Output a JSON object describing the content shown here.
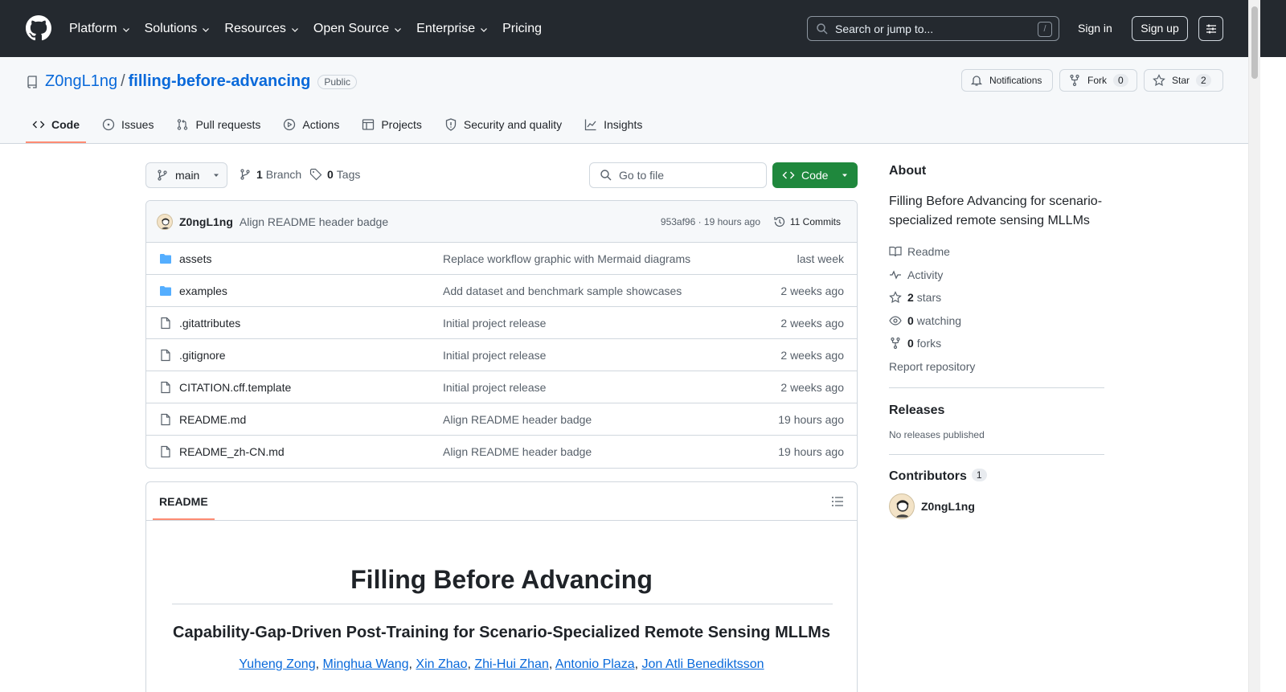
{
  "topnav": {
    "items": [
      "Platform",
      "Solutions",
      "Resources",
      "Open Source",
      "Enterprise",
      "Pricing"
    ],
    "search_placeholder": "Search or jump to...",
    "search_shortcut": "/",
    "signin": "Sign in",
    "signup": "Sign up"
  },
  "repo": {
    "owner": "Z0ngL1ng",
    "separator": "/",
    "name": "filling-before-advancing",
    "visibility": "Public",
    "notifications_label": "Notifications",
    "fork_label": "Fork",
    "fork_count": "0",
    "star_label": "Star",
    "star_count": "2"
  },
  "tabs": [
    "Code",
    "Issues",
    "Pull requests",
    "Actions",
    "Projects",
    "Security and quality",
    "Insights"
  ],
  "toolbar": {
    "branch": "main",
    "branch_count": "1",
    "branch_label": "Branch",
    "tag_count": "0",
    "tag_label": "Tags",
    "goto_placeholder": "Go to file",
    "code_label": "Code"
  },
  "commit": {
    "author": "Z0ngL1ng",
    "message": "Align README header badge",
    "hash_age": "953af96 · 19 hours ago",
    "commits": "11 Commits"
  },
  "files": [
    {
      "type": "folder",
      "name": "assets",
      "message": "Replace workflow graphic with Mermaid diagrams",
      "age": "last week"
    },
    {
      "type": "folder",
      "name": "examples",
      "message": "Add dataset and benchmark sample showcases",
      "age": "2 weeks ago"
    },
    {
      "type": "file",
      "name": ".gitattributes",
      "message": "Initial project release",
      "age": "2 weeks ago"
    },
    {
      "type": "file",
      "name": ".gitignore",
      "message": "Initial project release",
      "age": "2 weeks ago"
    },
    {
      "type": "file",
      "name": "CITATION.cff.template",
      "message": "Initial project release",
      "age": "2 weeks ago"
    },
    {
      "type": "file",
      "name": "README.md",
      "message": "Align README header badge",
      "age": "19 hours ago"
    },
    {
      "type": "file",
      "name": "README_zh-CN.md",
      "message": "Align README header badge",
      "age": "19 hours ago"
    }
  ],
  "readme": {
    "tab": "README",
    "title": "Filling Before Advancing",
    "subtitle": "Capability-Gap-Driven Post-Training for Scenario-Specialized Remote Sensing MLLMs",
    "authors": [
      "Yuheng Zong",
      "Minghua Wang",
      "Xin Zhao",
      "Zhi-Hui Zhan",
      "Antonio Plaza",
      "Jon Atli Benediktsson"
    ]
  },
  "about": {
    "heading": "About",
    "description": "Filling Before Advancing for scenario-specialized remote sensing MLLMs",
    "readme": "Readme",
    "activity": "Activity",
    "stars_count": "2",
    "stars_label": "stars",
    "watching_count": "0",
    "watching_label": "watching",
    "forks_count": "0",
    "forks_label": "forks",
    "report": "Report repository"
  },
  "releases": {
    "heading": "Releases",
    "text": "No releases published"
  },
  "contributors": {
    "heading": "Contributors",
    "count": "1",
    "list": [
      "Z0ngL1ng"
    ]
  }
}
